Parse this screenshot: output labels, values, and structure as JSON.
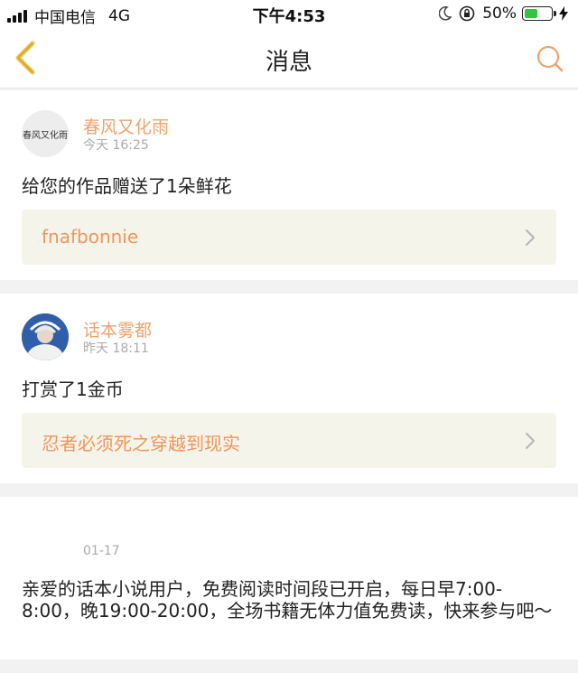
{
  "status_bar": {
    "carrier": "中国电信",
    "network": "4G",
    "time": "下午4:53",
    "battery_percent_label": "50%",
    "battery_level": 0.5,
    "battery_color": "#33c440"
  },
  "nav": {
    "title": "消息",
    "back_icon": "chevron-left-icon",
    "search_icon": "search-icon",
    "accent_color": "#f5c242"
  },
  "messages": [
    {
      "avatar_text": "春风又化雨",
      "user_name": "春风又化雨",
      "time": "今天 16:25",
      "text": "给您的作品赠送了1朵鲜花",
      "link_title": "fnafbonnie"
    },
    {
      "avatar_icon": "user-photo-avatar",
      "user_name": "话本雾都",
      "time": "昨天 18:11",
      "text": "打赏了1金币",
      "link_title": "忍者必须死之穿越到现实"
    }
  ],
  "notice": {
    "time": "01-17",
    "text": "亲爱的话本小说用户，免费阅读时间段已开启，每日早7:00-8:00，晚19:00-20:00，全场书籍无体力值免费读，快来参与吧～"
  }
}
